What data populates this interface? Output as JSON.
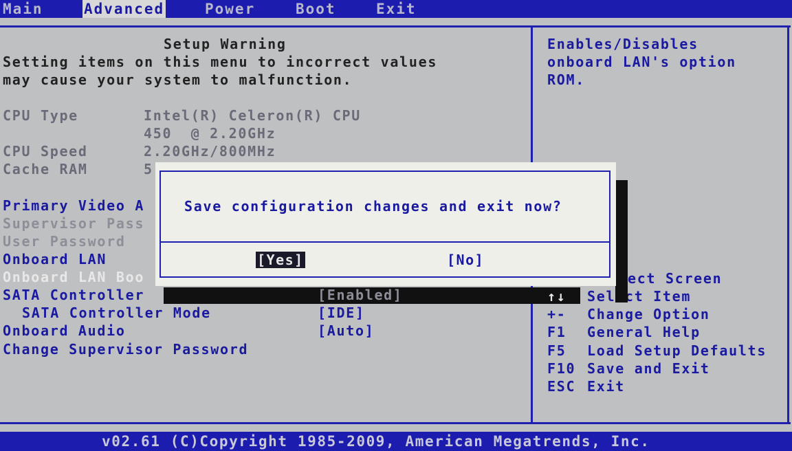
{
  "menu": {
    "tabs": [
      "Main",
      "Advanced",
      "Power",
      "Boot",
      "Exit"
    ],
    "active_tab": "Advanced"
  },
  "warning": {
    "title": "Setup Warning",
    "line1": "Setting items on this menu to incorrect values",
    "line2": "may cause your system to malfunction."
  },
  "info": {
    "cpu_type_label": "CPU Type",
    "cpu_type_value_1": "Intel(R) Celeron(R) CPU",
    "cpu_type_value_2": "450  @ 2.20GHz",
    "cpu_speed_label": "CPU Speed",
    "cpu_speed_value": "2.20GHz/800MHz",
    "cache_ram_label": "Cache RAM",
    "cache_ram_value": "5"
  },
  "settings": {
    "primary_video": "Primary Video A",
    "supervisor_password": "Supervisor Pass",
    "user_password": "User Password",
    "onboard_lan": "Onboard LAN",
    "onboard_lan_boot": "Onboard LAN Boo",
    "sata_controller": "SATA Controller",
    "sata_controller_value": "[Enabled]",
    "sata_controller_mode": "SATA Controller Mode",
    "sata_controller_mode_value": "[IDE]",
    "onboard_audio": "Onboard Audio",
    "onboard_audio_value": "[Auto]",
    "change_supervisor_password": "Change Supervisor Password"
  },
  "help": {
    "line1": "Enables/Disables",
    "line2": "onboard LAN's option",
    "line3": "ROM."
  },
  "keys": {
    "select_screen_partial": "ect Screen",
    "select_item_key": "↑↓",
    "select_item": "Select Item",
    "change_option_key": "+-",
    "change_option": "Change Option",
    "f1_key": "F1",
    "f1": "General Help",
    "f5_key": "F5",
    "f5": "Load Setup Defaults",
    "f10_key": "F10",
    "f10": "Save and Exit",
    "esc_key": "ESC",
    "esc": "Exit"
  },
  "dialog": {
    "message": "Save configuration changes and exit now?",
    "yes": "[Yes]",
    "no": "[No]"
  },
  "footer": {
    "copyright": "v02.61 (C)Copyright 1985-2009, American Megatrends, Inc."
  }
}
